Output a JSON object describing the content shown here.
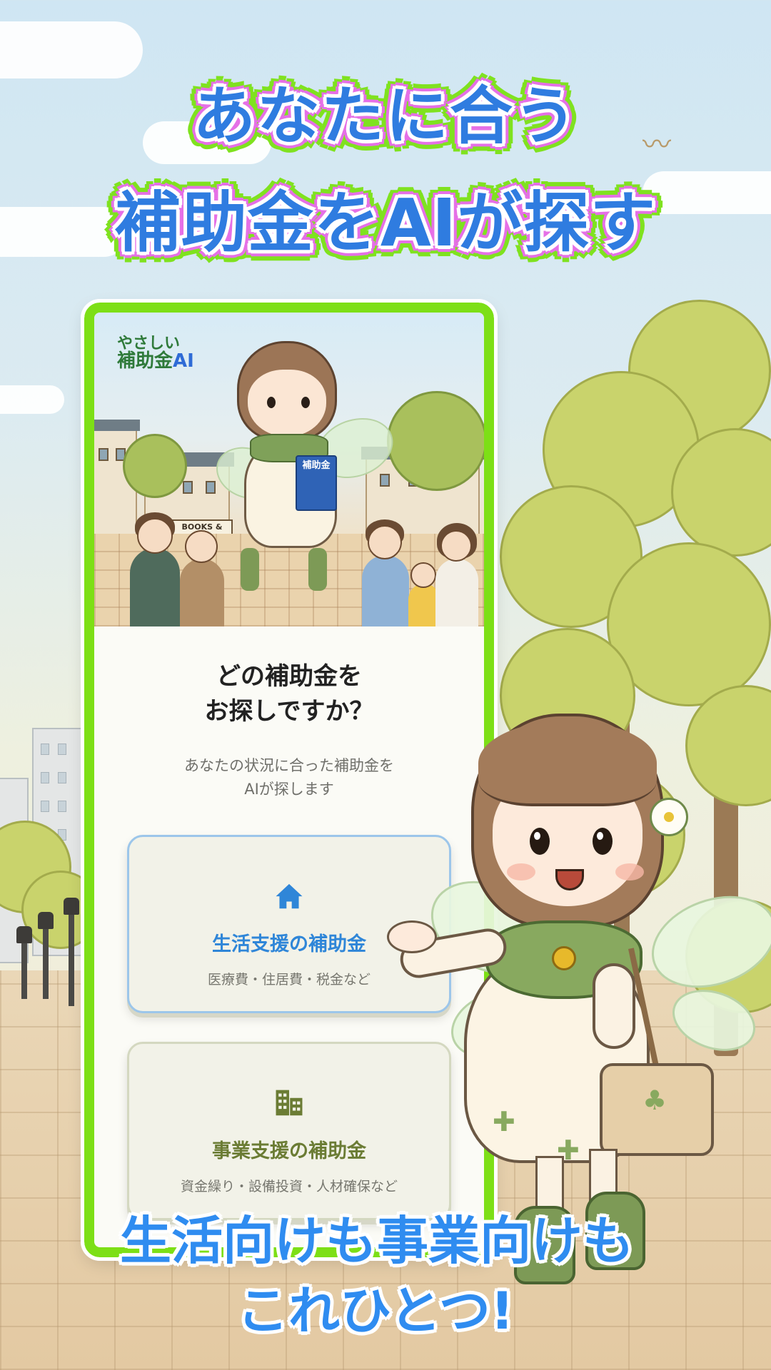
{
  "headline": {
    "line1": "あなたに合う",
    "line2": "補助金をAIが探す"
  },
  "footer": {
    "line1": "生活向けも事業向けも",
    "line2": "これひとつ!"
  },
  "app": {
    "logo_line1": "やさしい",
    "logo_line2_prefix": "補助金",
    "logo_line2_ai": "AI",
    "hero_sign": "BOOKS & CAFE",
    "hero_clipboard": "補助金",
    "question_line1": "どの補助金を",
    "question_line2": "お探しですか？",
    "subtitle_line1": "あなたの状況に合った補助金を",
    "subtitle_line2": "AIが探します",
    "options": [
      {
        "title": "生活支援の補助金",
        "description": "医療費・住居費・税金など",
        "icon": "home-icon",
        "color": "#2f86d8"
      },
      {
        "title": "事業支援の補助金",
        "description": "資金繰り・設備投資・人材確保など",
        "icon": "building-icon",
        "color": "#6b7c34"
      }
    ]
  },
  "colors": {
    "frame_green": "#7ddf16",
    "headline_blue": "#2f7ce0",
    "headline_pink_outline": "#e570e6",
    "accent_blue": "#2f86d8",
    "accent_olive": "#6b7c34"
  }
}
